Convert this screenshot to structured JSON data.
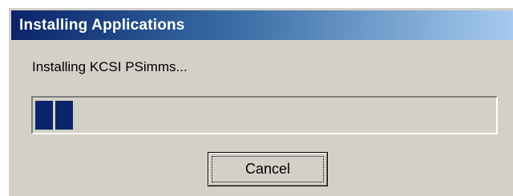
{
  "window": {
    "title": "Installing Applications"
  },
  "status": {
    "text": "Installing KCSI PSimms..."
  },
  "progress": {
    "filled_blocks": 2,
    "fraction": 0.08,
    "color": "#0a246a"
  },
  "buttons": {
    "cancel_label": "Cancel"
  },
  "colors": {
    "titlebar_start": "#0a246a",
    "titlebar_end": "#a6caf0",
    "window_face": "#d4d0c8"
  }
}
